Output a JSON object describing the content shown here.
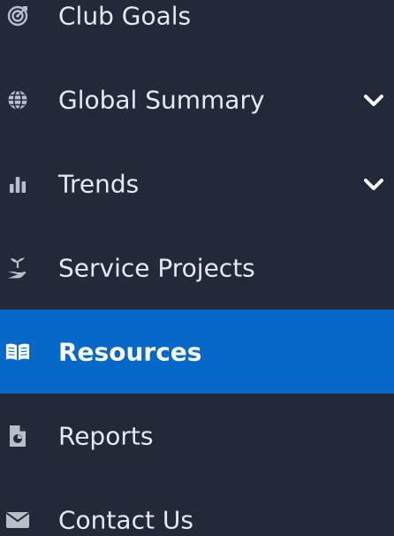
{
  "sidebar": {
    "items": [
      {
        "label": "Club Goals",
        "icon": "target-icon",
        "has_chevron": false,
        "active": false
      },
      {
        "label": "Global Summary",
        "icon": "globe-icon",
        "has_chevron": true,
        "active": false
      },
      {
        "label": "Trends",
        "icon": "bar-chart-icon",
        "has_chevron": true,
        "active": false
      },
      {
        "label": "Service Projects",
        "icon": "hand-sprout-icon",
        "has_chevron": false,
        "active": false
      },
      {
        "label": "Resources",
        "icon": "open-book-icon",
        "has_chevron": false,
        "active": true
      },
      {
        "label": "Reports",
        "icon": "report-document-icon",
        "has_chevron": false,
        "active": false
      },
      {
        "label": "Contact Us",
        "icon": "envelope-icon",
        "has_chevron": false,
        "active": false
      }
    ]
  },
  "colors": {
    "background": "#222a3a",
    "active_background": "#0668c8",
    "text": "#e6e9ef",
    "icon": "#b9bec9"
  }
}
